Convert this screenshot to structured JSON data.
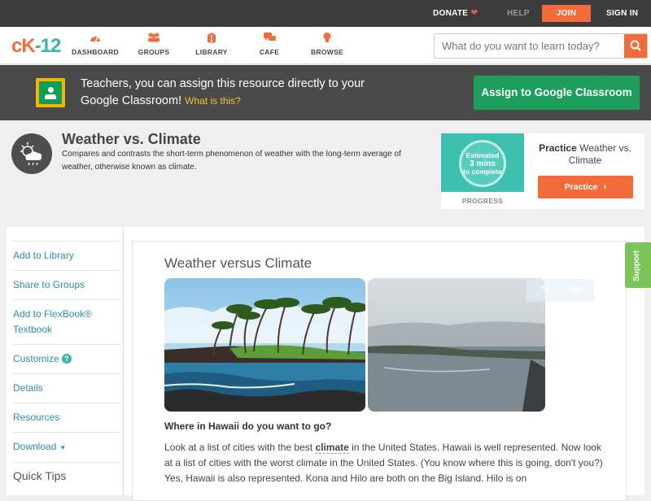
{
  "topbar": {
    "donate": "DONATE",
    "help": "HELP",
    "join": "JOIN",
    "signin": "SIGN IN"
  },
  "header": {
    "logo_c": "cK",
    "logo_k": "-12",
    "nav": [
      {
        "label": "DASHBOARD",
        "icon": "dashboard-icon"
      },
      {
        "label": "GROUPS",
        "icon": "groups-icon"
      },
      {
        "label": "LIBRARY",
        "icon": "library-icon"
      },
      {
        "label": "CAFE",
        "icon": "cafe-icon"
      },
      {
        "label": "BROWSE",
        "icon": "browse-icon"
      }
    ],
    "search_placeholder": "What do you want to learn today?"
  },
  "banner": {
    "text": "Teachers, you can assign this resource directly to your Google Classroom!",
    "link": "What is this?",
    "button": "Assign to Google Classroom"
  },
  "resource": {
    "title": "Weather vs. Climate",
    "description": "Compares and contrasts the short-term phenomenon of weather with the long-term average of weather, otherwise known as climate."
  },
  "practice": {
    "estimated_l1": "Estimated",
    "estimated_l2": "3 mins",
    "estimated_l3": "to complete",
    "progress_label": "PROGRESS",
    "title_bold": "Practice",
    "title_rest": "Weather vs. Climate",
    "button": "Practice"
  },
  "sidebar": {
    "items": [
      "Add to Library",
      "Share to Groups",
      "Add to FlexBook® Textbook",
      "Customize",
      "Details",
      "Resources",
      "Download"
    ],
    "quick_tips": "Quick Tips"
  },
  "content": {
    "title": "Weather versus Climate",
    "heading": "Where in Hawaii do you want to go?",
    "para_a": "Look at a list of cities with the best ",
    "vocab": "climate",
    "para_b": " in the United States. Hawaii is well represented. Now look at a list of cities with the worst climate in the United States. (You know where this is going, don't you?) Yes, Hawaii is also represented. Kona and Hilo are both on the Big Island. Hilo is on"
  },
  "support": "Support",
  "colors": {
    "accent": "#f26b3a",
    "teal": "#3ab5a6",
    "google_green": "#1e9e5c",
    "link": "#2a8fa5"
  }
}
